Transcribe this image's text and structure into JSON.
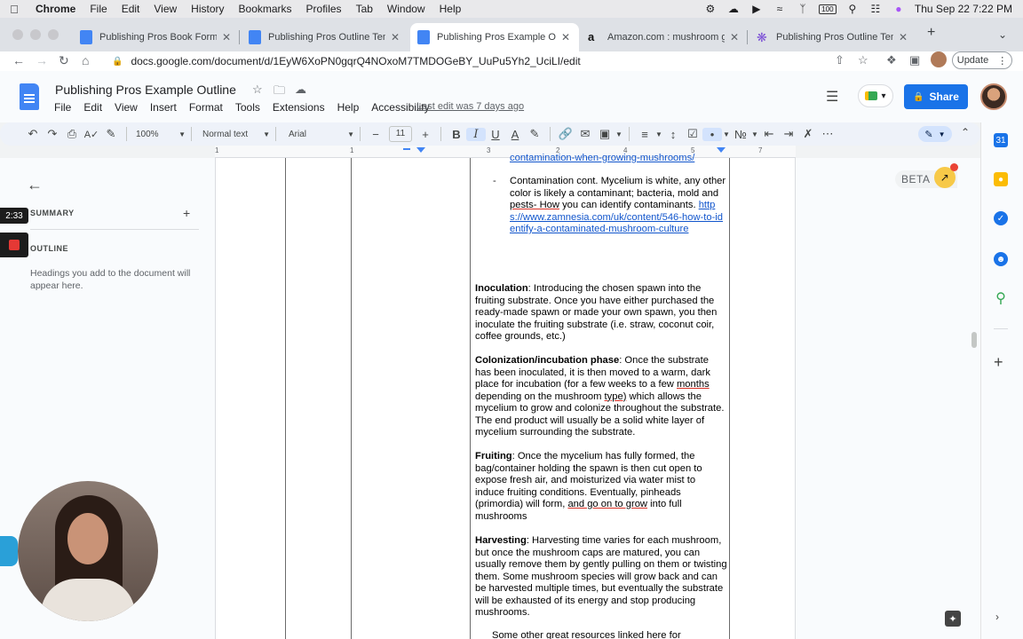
{
  "menubar": {
    "app": "Chrome",
    "items": [
      "File",
      "Edit",
      "View",
      "History",
      "Bookmarks",
      "Profiles",
      "Tab",
      "Window",
      "Help"
    ],
    "battery": "100",
    "datetime": "Thu Sep 22  7:22 PM"
  },
  "tabs": [
    {
      "label": "Publishing Pros Book Format G",
      "icon": "docs-icon"
    },
    {
      "label": "Publishing Pros Outline Templ",
      "icon": "docs-icon"
    },
    {
      "label": "Publishing Pros Example Outlin",
      "icon": "docs-icon"
    },
    {
      "label": "Amazon.com : mushroom grow",
      "icon": "amazon-icon"
    },
    {
      "label": "Publishing Pros Outline Templ",
      "icon": "ai-icon"
    }
  ],
  "address": {
    "url": "docs.google.com/document/d/1EyW6XoPN0gqrQ4NOxoM7TMDOGeBY_UuPu5Yh2_UciLI/edit",
    "update_label": "Update"
  },
  "doc": {
    "title": "Publishing Pros Example Outline",
    "menu": [
      "File",
      "Edit",
      "View",
      "Insert",
      "Format",
      "Tools",
      "Extensions",
      "Help",
      "Accessibility"
    ],
    "last_edit": "Last edit was 7 days ago",
    "share_label": "Share"
  },
  "toolbar": {
    "zoom": "100%",
    "style": "Normal text",
    "font": "Arial",
    "font_size": "11"
  },
  "ruler": {
    "numbers": [
      "1",
      "1",
      "2",
      "3",
      "4",
      "5",
      "6",
      "7"
    ]
  },
  "outline": {
    "summary_title": "SUMMARY",
    "outline_title": "OUTLINE",
    "hint": "Headings you add to the document will appear here."
  },
  "recorder": {
    "timer": "2:33"
  },
  "beta": {
    "label": "BETA"
  },
  "content": {
    "top_link": "contamination-when-growing-mushrooms/",
    "contamination": {
      "t1": "Contamination cont. Mycelium is white, any other color is likely a contaminant; bacteria, mold and ",
      "t2": "pests- How",
      "t3": " you can identify contaminants. ",
      "link": "https://www.zamnesia.com/uk/content/546-how-to-identify-a-contaminated-mushroom-culture"
    },
    "inoculation": {
      "head": "Inoculation",
      "body": ": Introducing the chosen spawn into the fruiting substrate.  Once you have either purchased the ready-made spawn or made your own spawn, you then inoculate the fruiting substrate (i.e. straw, coconut coir, coffee grounds, etc.)"
    },
    "colonization": {
      "head": "Colonization/incubation phase",
      "b1": ": Once the substrate has been inoculated, it is then moved to a warm, dark place for incubation (for a few weeks to a few ",
      "u1": "months",
      "b2": " depending on the mushroom ",
      "u2": "type)",
      "b3": " which allows the mycelium to grow and colonize throughout the substrate.  The end product will usually be a solid white layer of mycelium surrounding the substrate."
    },
    "fruiting": {
      "head": "Fruiting",
      "b1": ": Once the mycelium has fully formed, the bag/container holding the spawn is then cut open to expose fresh air, and moisturized via water mist to induce fruiting conditions. Eventually, pinheads (primordia) will form, ",
      "u1": "and go on to grow",
      "b2": " into full mushrooms"
    },
    "harvesting": {
      "head": "Harvesting",
      "body": ": Harvesting time varies for each mushroom, but once the mushroom caps are matured, you can usually remove them by gently pulling on them or twisting them.  Some mushroom species will grow back and can be harvested multiple times, but eventually the substrate will be exhausted of its energy and stop producing mushrooms."
    },
    "bottom": "Some other great resources linked here for"
  }
}
